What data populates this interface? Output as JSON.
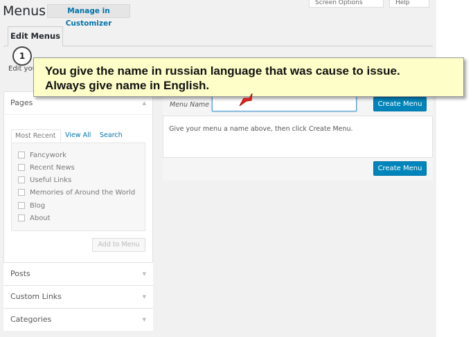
{
  "header": {
    "title": "Menus",
    "customizer_button": "Manage in Customizer",
    "screen_options": "Screen Options",
    "help": "Help"
  },
  "nav_tabs": {
    "edit_menus": "Edit Menus"
  },
  "partial_text": "Edit you",
  "annotation": {
    "step_number": "1",
    "line1": "You give the name in russian language that was cause to issue.",
    "line2": "Always give name in English."
  },
  "left_panel": {
    "pages": {
      "title": "Pages",
      "tabs": [
        "Most Recent",
        "View All",
        "Search"
      ],
      "items": [
        "Fancywork",
        "Recent News",
        "Useful Links",
        "Memories of Around the World",
        "Blog",
        "About"
      ],
      "add_button": "Add to Menu"
    },
    "sections": [
      "Posts",
      "Custom Links",
      "Categories"
    ]
  },
  "editor": {
    "menu_name_label": "Menu Name",
    "menu_name_value": "",
    "create_button": "Create Menu",
    "instructions": "Give your menu a name above, then click Create Menu."
  },
  "colors": {
    "accent": "#0085ba",
    "link": "#0073aa",
    "callout_bg": "#fefec8",
    "pointer": "#e8231f"
  }
}
